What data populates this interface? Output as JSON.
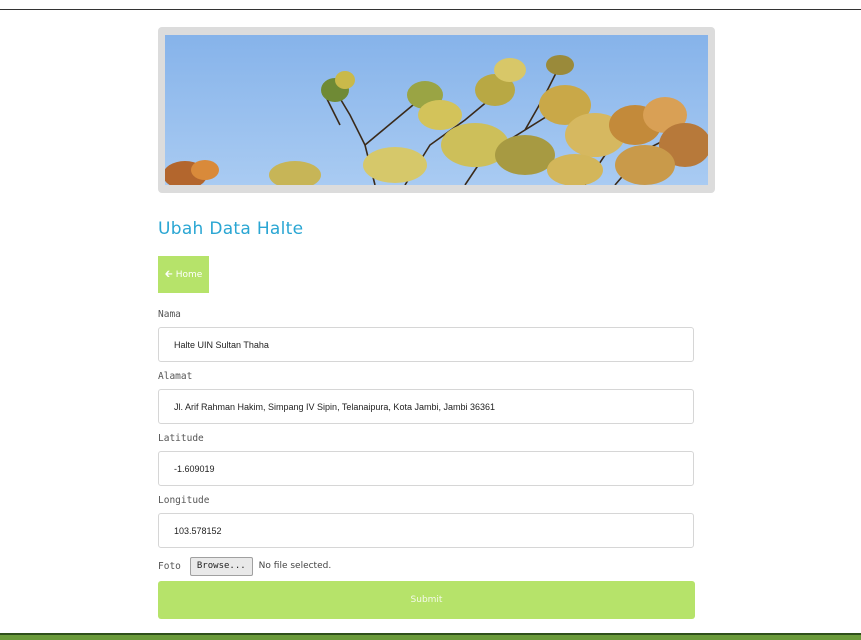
{
  "page": {
    "title": "Ubah Data Halte"
  },
  "nav": {
    "home_label": "Home",
    "home_icon": "arrow-left-icon"
  },
  "form": {
    "nama_label": "Nama",
    "nama_value": "Halte UIN Sultan Thaha",
    "alamat_label": "Alamat",
    "alamat_value": "Jl. Arif Rahman Hakim, Simpang IV Sipin, Telanaipura, Kota Jambi, Jambi 36361",
    "latitude_label": "Latitude",
    "latitude_value": "-1.609019",
    "longitude_label": "Longitude",
    "longitude_value": "103.578152",
    "foto_label": "Foto",
    "browse_label": "Browse...",
    "file_status": "No file selected.",
    "submit_label": "Submit"
  },
  "colors": {
    "accent_green": "#b6e36a",
    "title_blue": "#2aa6d3",
    "footer_green": "#6a9a3a"
  }
}
